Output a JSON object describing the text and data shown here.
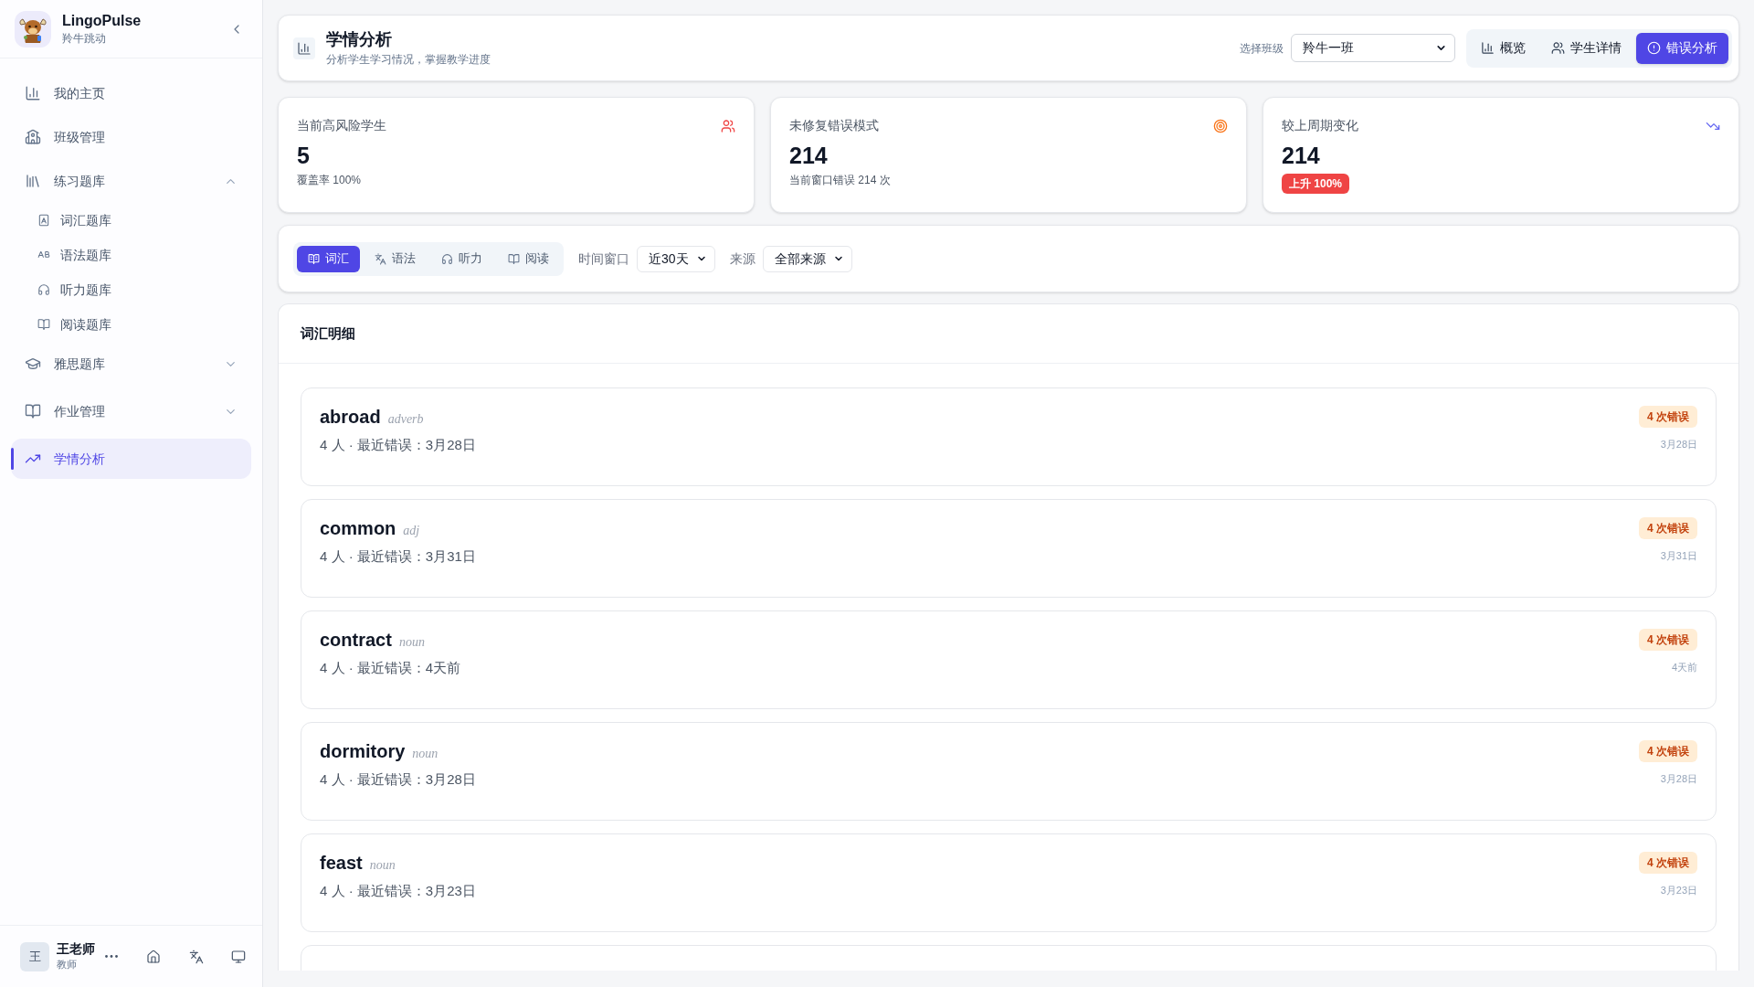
{
  "sidebar": {
    "brand": {
      "name": "LingoPulse",
      "subtitle": "羚牛跳动"
    },
    "items": [
      {
        "label": "我的主页",
        "selected": false
      },
      {
        "label": "班级管理",
        "selected": false
      },
      {
        "label": "练习题库",
        "selected": false,
        "expanded": true,
        "children": [
          {
            "label": "词汇题库",
            "selected": false
          },
          {
            "label": "语法题库",
            "selected": false
          },
          {
            "label": "听力题库",
            "selected": false
          },
          {
            "label": "阅读题库",
            "selected": false
          }
        ]
      },
      {
        "label": "雅思题库",
        "selected": false,
        "expanded": false
      },
      {
        "label": "作业管理",
        "selected": false,
        "expanded": false
      },
      {
        "label": "学情分析",
        "selected": true
      }
    ],
    "user": {
      "avatar": "王",
      "name": "王老师",
      "role": "教师"
    }
  },
  "header": {
    "title": "学情分析",
    "subtitle": "分析学生学习情况，掌握教学进度",
    "class_select": {
      "label": "选择班级",
      "value": "羚牛一班"
    },
    "views": [
      {
        "label": "概览",
        "selected": false
      },
      {
        "label": "学生详情",
        "selected": false
      },
      {
        "label": "错误分析",
        "selected": true
      }
    ]
  },
  "stats": [
    {
      "label": "当前高风险学生",
      "value": "5",
      "note": "覆盖率 100%"
    },
    {
      "label": "未修复错误模式",
      "value": "214",
      "note": "当前窗口错误 214 次"
    },
    {
      "label": "较上周期变化",
      "value": "214",
      "badge": "上升 100%"
    }
  ],
  "filters": {
    "tabs": [
      {
        "label": "词汇",
        "selected": true
      },
      {
        "label": "语法",
        "selected": false
      },
      {
        "label": "听力",
        "selected": false
      },
      {
        "label": "阅读",
        "selected": false
      }
    ],
    "time_window": {
      "label": "时间窗口",
      "value": "近30天"
    },
    "source": {
      "label": "来源",
      "value": "全部来源"
    }
  },
  "details": {
    "title": "词汇明细",
    "items": [
      {
        "word": "abroad",
        "pos": "adverb",
        "meta": "4 人 · 最近错误：3月28日",
        "badge": "4 次错误",
        "date": "3月28日"
      },
      {
        "word": "common",
        "pos": "adj",
        "meta": "4 人 · 最近错误：3月31日",
        "badge": "4 次错误",
        "date": "3月31日"
      },
      {
        "word": "contract",
        "pos": "noun",
        "meta": "4 人 · 最近错误：4天前",
        "badge": "4 次错误",
        "date": "4天前"
      },
      {
        "word": "dormitory",
        "pos": "noun",
        "meta": "4 人 · 最近错误：3月28日",
        "badge": "4 次错误",
        "date": "3月28日"
      },
      {
        "word": "feast",
        "pos": "noun",
        "meta": "4 人 · 最近错误：3月23日",
        "badge": "4 次错误",
        "date": "3月23日"
      }
    ]
  }
}
